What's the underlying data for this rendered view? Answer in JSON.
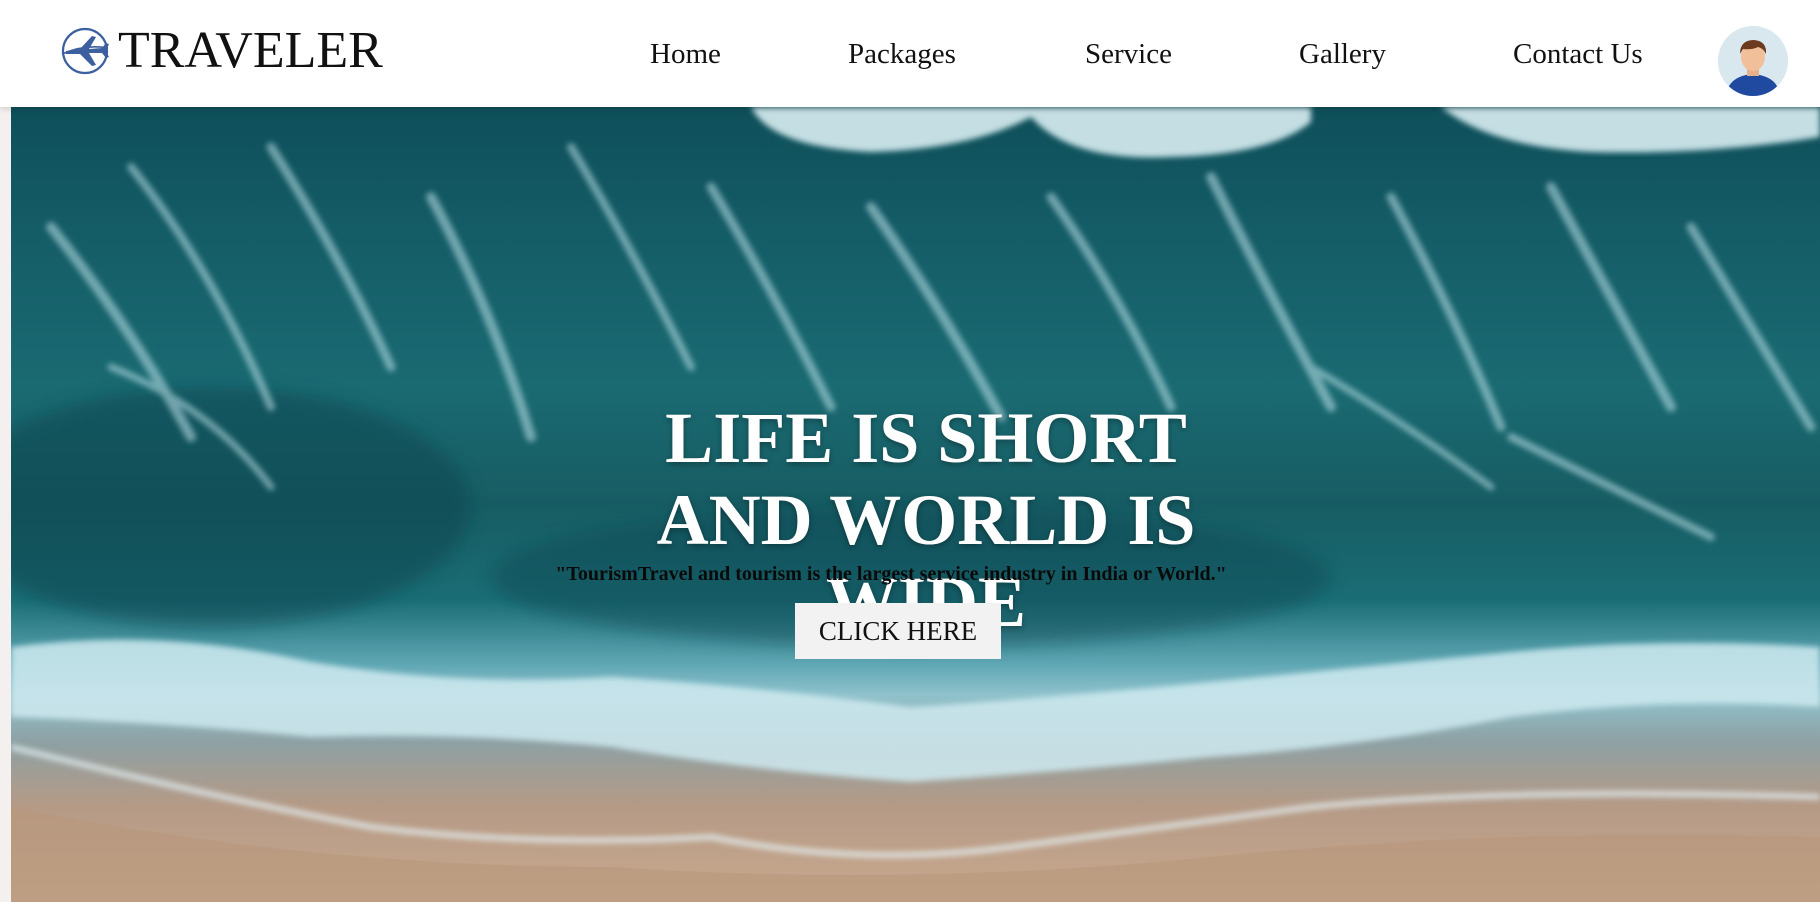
{
  "brand": {
    "name": "TRAVELER",
    "logo_icon": "airplane-globe-icon"
  },
  "nav": {
    "items": [
      {
        "label": "Home"
      },
      {
        "label": "Packages"
      },
      {
        "label": "Service"
      },
      {
        "label": "Gallery"
      },
      {
        "label": "Contact Us"
      }
    ]
  },
  "user": {
    "avatar_icon": "user-avatar-icon"
  },
  "hero": {
    "headline": "LIFE IS SHORT AND WORLD IS WIDE",
    "tagline": "\"TourismTravel and tourism is the largest service industry in India or World.\"",
    "cta_label": "CLICK HERE",
    "background": "aerial-ocean-waves-beach-image"
  },
  "colors": {
    "nav_bg": "#ffffff",
    "ocean_deep": "#0e4f5a",
    "sand": "#c9a98e",
    "cta_bg": "#f2f2f2"
  }
}
